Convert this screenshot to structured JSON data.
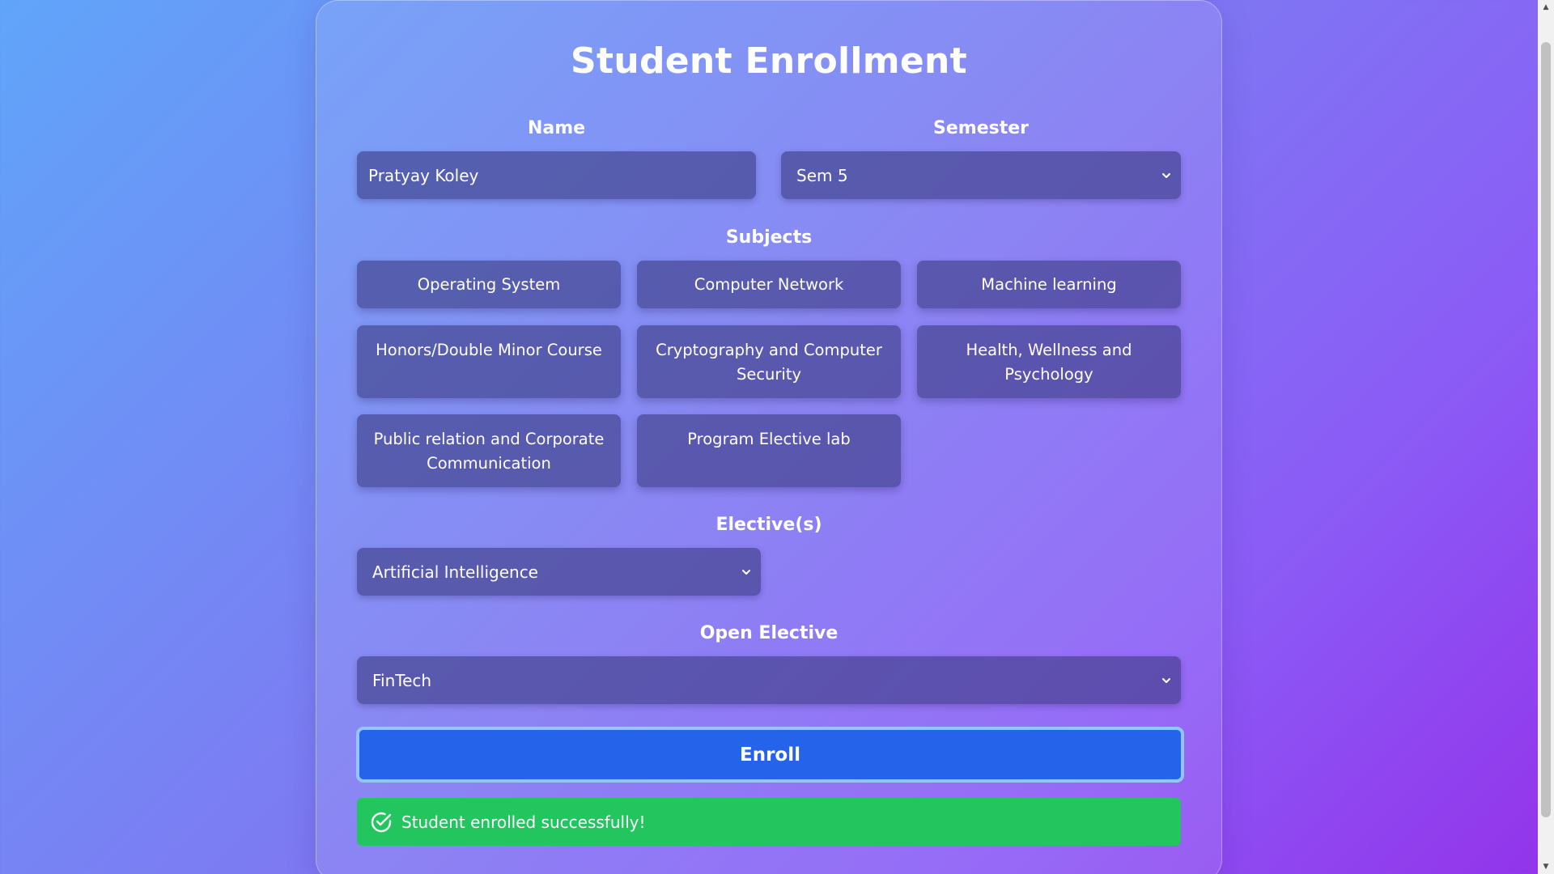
{
  "form": {
    "title": "Student Enrollment",
    "name_label": "Name",
    "name_value": "Pratyay Koley",
    "semester_label": "Semester",
    "semester_value": "Sem 5",
    "subjects_label": "Subjects",
    "subjects": [
      "Operating System",
      "Computer Network",
      "Machine learning",
      "Honors/Double Minor Course",
      "Cryptography and Computer Security",
      "Health, Wellness and Psychology",
      "Public relation and Corporate Communication",
      "Program Elective lab"
    ],
    "electives_label": "Elective(s)",
    "elective_value": "Artificial Intelligence",
    "open_elective_label": "Open Elective",
    "open_elective_value": "FinTech",
    "enroll_label": "Enroll",
    "success_message": "Student enrolled successfully!"
  },
  "icons": {
    "dropdown": "chevron-down-icon",
    "success": "check-circle-icon",
    "scroll_up": "arrow-up-icon",
    "scroll_down": "arrow-down-icon"
  },
  "colors": {
    "background_start": "#60a5fa",
    "background_end": "#9333ea",
    "field_background": "#4f4f8f",
    "enroll_button": "#2563eb",
    "enroll_border": "#93c5fd",
    "success": "#22c55e"
  }
}
